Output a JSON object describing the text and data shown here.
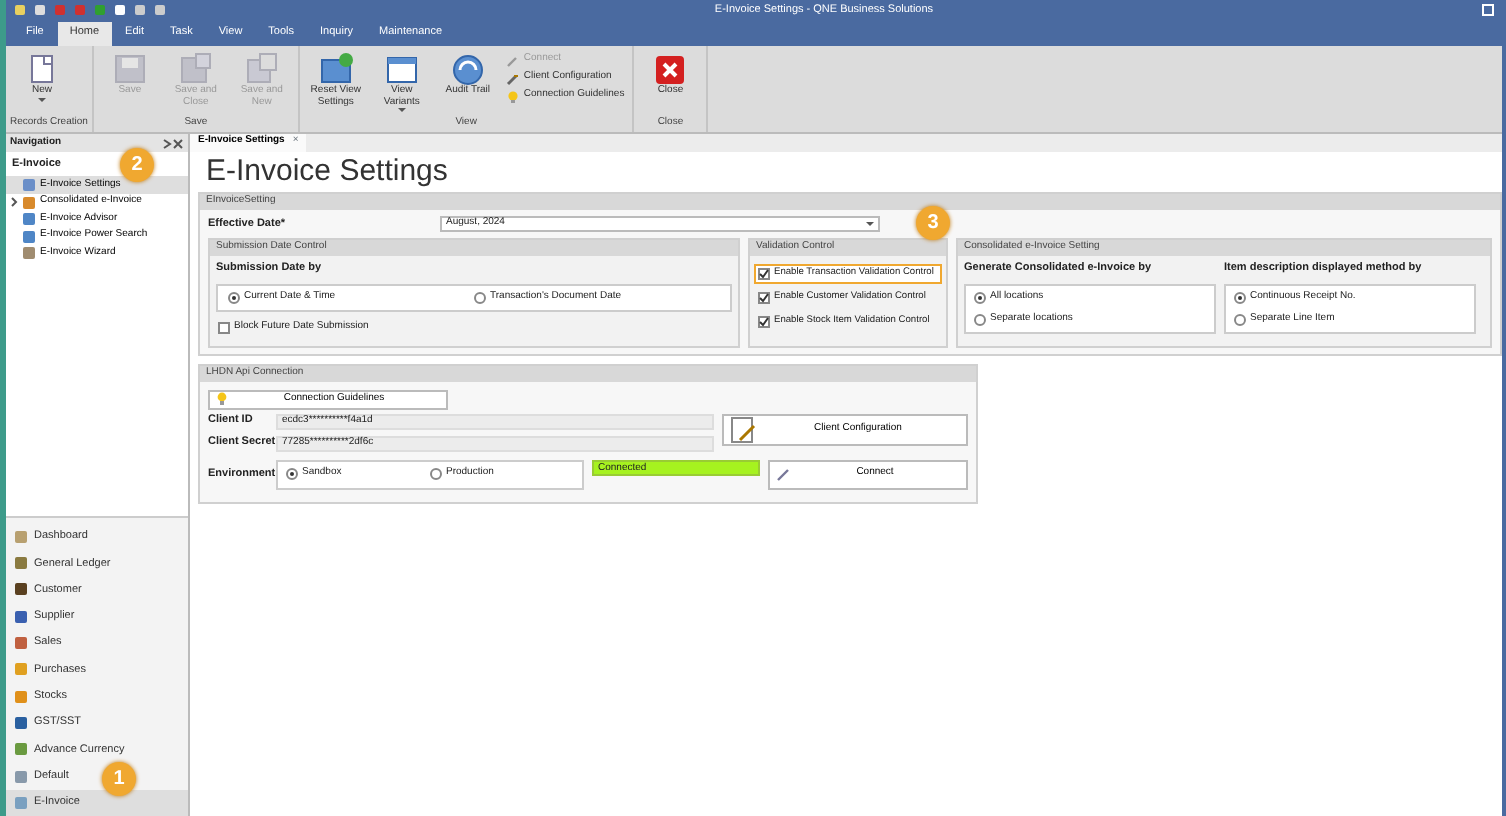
{
  "window": {
    "title": "E-Invoice Settings - QNE Business Solutions"
  },
  "menu_tabs": [
    {
      "label": "File",
      "selected": false
    },
    {
      "label": "Home",
      "selected": true
    },
    {
      "label": "Edit",
      "selected": false
    },
    {
      "label": "Task",
      "selected": false
    },
    {
      "label": "View",
      "selected": false
    },
    {
      "label": "Tools",
      "selected": false
    },
    {
      "label": "Inquiry",
      "selected": false
    },
    {
      "label": "Maintenance",
      "selected": false
    }
  ],
  "ribbon_groups": [
    {
      "label": "Records Creation",
      "buttons": [
        {
          "label": "New",
          "kind": "large",
          "disabled": false,
          "dropdown": true
        }
      ]
    },
    {
      "label": "Save",
      "buttons": [
        {
          "label": "Save",
          "kind": "large",
          "disabled": true,
          "dropdown": false
        },
        {
          "label": "Save and Close",
          "kind": "large",
          "disabled": true,
          "dropdown": false
        },
        {
          "label": "Save and New",
          "kind": "large",
          "disabled": true,
          "dropdown": false
        }
      ]
    },
    {
      "label": "View",
      "buttons": [
        {
          "label": "Reset View Settings",
          "kind": "large",
          "disabled": false,
          "dropdown": false
        },
        {
          "label": "View Variants",
          "kind": "large",
          "disabled": false,
          "dropdown": true
        },
        {
          "label": "Audit Trail",
          "kind": "large",
          "disabled": false,
          "dropdown": false
        },
        {
          "label": "Connect",
          "kind": "small",
          "disabled": true
        },
        {
          "label": "Client Configuration",
          "kind": "small",
          "disabled": false
        },
        {
          "label": "Connection Guidelines",
          "kind": "small",
          "disabled": false
        }
      ]
    },
    {
      "label": "Close",
      "buttons": [
        {
          "label": "Close",
          "kind": "large",
          "disabled": false,
          "dropdown": false
        }
      ]
    }
  ],
  "navigation": {
    "title": "Navigation",
    "section": "E-Invoice",
    "items": [
      {
        "label": "E-Invoice Settings",
        "selected": true,
        "kind": "leaf"
      },
      {
        "label": "Consolidated e-Invoice",
        "selected": false,
        "kind": "group"
      },
      {
        "label": "E-Invoice Advisor",
        "selected": false,
        "kind": "leaf"
      },
      {
        "label": "E-Invoice Power Search",
        "selected": false,
        "kind": "leaf"
      },
      {
        "label": "E-Invoice Wizard",
        "selected": false,
        "kind": "leaf"
      }
    ],
    "modules": [
      {
        "label": "Dashboard",
        "selected": false
      },
      {
        "label": "General Ledger",
        "selected": false
      },
      {
        "label": "Customer",
        "selected": false
      },
      {
        "label": "Supplier",
        "selected": false
      },
      {
        "label": "Sales",
        "selected": false
      },
      {
        "label": "Purchases",
        "selected": false
      },
      {
        "label": "Stocks",
        "selected": false
      },
      {
        "label": "GST/SST",
        "selected": false
      },
      {
        "label": "Advance Currency",
        "selected": false
      },
      {
        "label": "Default",
        "selected": false
      },
      {
        "label": "E-Invoice",
        "selected": true
      }
    ]
  },
  "document_tabs": [
    {
      "label": "E-Invoice Settings",
      "selected": true,
      "close": "×"
    }
  ],
  "heading": "E-Invoice Settings",
  "settings": {
    "title": "EInvoiceSetting",
    "effective_date": {
      "label": "Effective Date*",
      "value": "August, 2024"
    },
    "submission": {
      "title": "Submission Date Control",
      "label": "Submission Date by",
      "options": [
        {
          "label": "Current Date & Time",
          "selected": true
        },
        {
          "label": "Transaction's Document Date",
          "selected": false
        }
      ],
      "block_future": {
        "label": "Block Future Date Submission",
        "checked": false
      }
    },
    "validation": {
      "title": "Validation Control",
      "checks": [
        {
          "label": "Enable Transaction Validation Control",
          "checked": true,
          "highlighted": true
        },
        {
          "label": "Enable Customer Validation Control",
          "checked": true,
          "highlighted": false
        },
        {
          "label": "Enable Stock Item Validation Control",
          "checked": true,
          "highlighted": false
        }
      ]
    },
    "consolidated": {
      "title": "Consolidated e-Invoice Setting",
      "groups": [
        {
          "label": "Generate Consolidated e-Invoice by",
          "options": [
            {
              "label": "All locations",
              "selected": true
            },
            {
              "label": "Separate locations",
              "selected": false
            }
          ]
        },
        {
          "label": "Item description displayed method by",
          "options": [
            {
              "label": "Continuous Receipt No.",
              "selected": true
            },
            {
              "label": "Separate Line Item",
              "selected": false
            }
          ]
        }
      ]
    }
  },
  "connection": {
    "title": "LHDN Api Connection",
    "guidelines_button": "Connection Guidelines",
    "client_id": {
      "label": "Client ID",
      "value": "ecdc3**********f4a1d"
    },
    "client_secret": {
      "label": "Client Secret",
      "value": "77285**********2df6c"
    },
    "client_config_button": "Client Configuration",
    "environment": {
      "label": "Environment",
      "options": [
        {
          "label": "Sandbox",
          "selected": true
        },
        {
          "label": "Production",
          "selected": false
        }
      ]
    },
    "status": "Connected",
    "connect_button": "Connect"
  },
  "callouts": [
    "1",
    "2",
    "3"
  ]
}
